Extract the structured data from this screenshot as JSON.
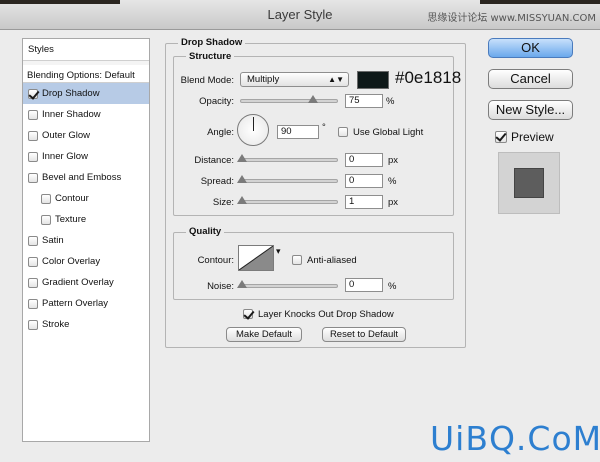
{
  "window": {
    "title": "Layer Style",
    "watermark": "思缘设计论坛 www.MISSYUAN.COM"
  },
  "styles_list": {
    "header": "Styles",
    "blending_options": "Blending Options: Default",
    "items": [
      {
        "label": "Drop Shadow",
        "checked": true,
        "selected": true
      },
      {
        "label": "Inner Shadow",
        "checked": false
      },
      {
        "label": "Outer Glow",
        "checked": false
      },
      {
        "label": "Inner Glow",
        "checked": false
      },
      {
        "label": "Bevel and Emboss",
        "checked": false
      },
      {
        "label": "Contour",
        "checked": false,
        "indent": true
      },
      {
        "label": "Texture",
        "checked": false,
        "indent": true
      },
      {
        "label": "Satin",
        "checked": false
      },
      {
        "label": "Color Overlay",
        "checked": false
      },
      {
        "label": "Gradient Overlay",
        "checked": false
      },
      {
        "label": "Pattern Overlay",
        "checked": false
      },
      {
        "label": "Stroke",
        "checked": false
      }
    ]
  },
  "drop_shadow": {
    "title": "Drop Shadow",
    "structure": {
      "title": "Structure",
      "blend_mode_label": "Blend Mode:",
      "blend_mode_value": "Multiply",
      "color": "#0e1818",
      "color_label": "#0e1818",
      "opacity_label": "Opacity:",
      "opacity_value": "75",
      "opacity_level": 0.75,
      "percent": "%",
      "angle_label": "Angle:",
      "angle_value": "90",
      "degree": "°",
      "use_global_light": "Use Global Light",
      "distance_label": "Distance:",
      "distance_value": "0",
      "spread_label": "Spread:",
      "spread_value": "0",
      "size_label": "Size:",
      "size_value": "1",
      "px": "px"
    },
    "quality": {
      "title": "Quality",
      "contour_label": "Contour:",
      "anti_aliased": "Anti-aliased",
      "noise_label": "Noise:",
      "noise_value": "0",
      "percent": "%"
    },
    "knocks_out": "Layer Knocks Out Drop Shadow",
    "make_default": "Make Default",
    "reset_default": "Reset to Default"
  },
  "right_panel": {
    "ok": "OK",
    "cancel": "Cancel",
    "new_style": "New Style...",
    "preview": "Preview"
  },
  "brand": "UiBQ.CoM"
}
